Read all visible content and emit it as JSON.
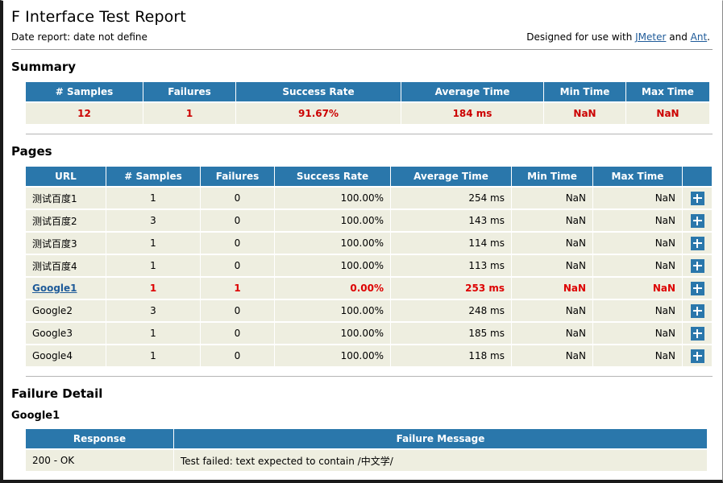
{
  "header": {
    "title": "F Interface Test Report",
    "date_report": "Date report: date not define",
    "designed_prefix": "Designed for use with ",
    "jmeter_link": "JMeter",
    "designed_mid": " and ",
    "ant_link": "Ant",
    "designed_suffix": "."
  },
  "colors": {
    "header_blue": "#2a77ab",
    "row_beige": "#eeeee0",
    "fail_red": "#dd0000",
    "link_blue": "#1f5b99"
  },
  "summary": {
    "section_title": "Summary",
    "columns": [
      "# Samples",
      "Failures",
      "Success Rate",
      "Average Time",
      "Min Time",
      "Max Time"
    ],
    "row": [
      "12",
      "1",
      "91.67%",
      "184 ms",
      "NaN",
      "NaN"
    ]
  },
  "pages": {
    "section_title": "Pages",
    "columns": [
      "URL",
      "# Samples",
      "Failures",
      "Success Rate",
      "Average Time",
      "Min Time",
      "Max Time"
    ],
    "expand_icon": "plus-icon",
    "rows": [
      {
        "url": "测试百度1",
        "samples": "1",
        "failures": "0",
        "success_rate": "100.00%",
        "average_time": "254 ms",
        "min_time": "NaN",
        "max_time": "NaN",
        "failed": false,
        "is_link": false
      },
      {
        "url": "测试百度2",
        "samples": "3",
        "failures": "0",
        "success_rate": "100.00%",
        "average_time": "143 ms",
        "min_time": "NaN",
        "max_time": "NaN",
        "failed": false,
        "is_link": false
      },
      {
        "url": "测试百度3",
        "samples": "1",
        "failures": "0",
        "success_rate": "100.00%",
        "average_time": "114 ms",
        "min_time": "NaN",
        "max_time": "NaN",
        "failed": false,
        "is_link": false
      },
      {
        "url": "测试百度4",
        "samples": "1",
        "failures": "0",
        "success_rate": "100.00%",
        "average_time": "113 ms",
        "min_time": "NaN",
        "max_time": "NaN",
        "failed": false,
        "is_link": false
      },
      {
        "url": "Google1",
        "samples": "1",
        "failures": "1",
        "success_rate": "0.00%",
        "average_time": "253 ms",
        "min_time": "NaN",
        "max_time": "NaN",
        "failed": true,
        "is_link": true
      },
      {
        "url": "Google2",
        "samples": "3",
        "failures": "0",
        "success_rate": "100.00%",
        "average_time": "248 ms",
        "min_time": "NaN",
        "max_time": "NaN",
        "failed": false,
        "is_link": false
      },
      {
        "url": "Google3",
        "samples": "1",
        "failures": "0",
        "success_rate": "100.00%",
        "average_time": "185 ms",
        "min_time": "NaN",
        "max_time": "NaN",
        "failed": false,
        "is_link": false
      },
      {
        "url": "Google4",
        "samples": "1",
        "failures": "0",
        "success_rate": "100.00%",
        "average_time": "118 ms",
        "min_time": "NaN",
        "max_time": "NaN",
        "failed": false,
        "is_link": false
      }
    ]
  },
  "failure_detail": {
    "section_title": "Failure Detail",
    "group_title": "Google1",
    "columns": [
      "Response",
      "Failure Message"
    ],
    "rows": [
      {
        "response": "200 - OK",
        "message": "Test failed: text expected to contain /中文学/"
      }
    ]
  }
}
